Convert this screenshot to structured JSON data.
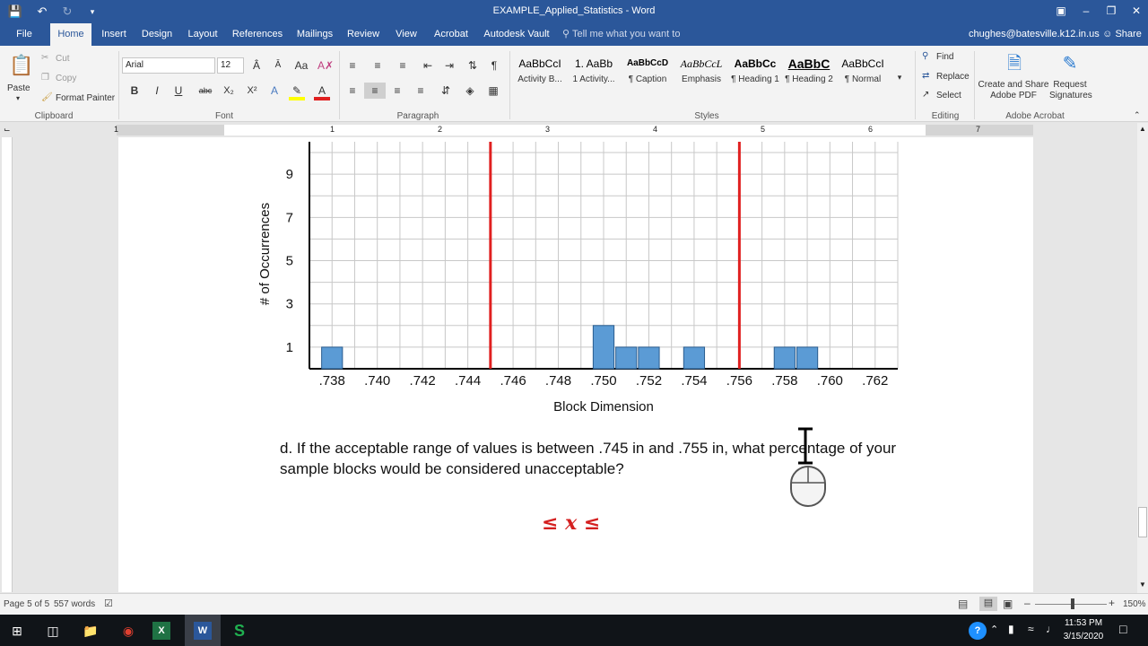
{
  "window": {
    "title": "EXAMPLE_Applied_Statistics - Word",
    "qat": [
      "save-icon",
      "undo-icon",
      "redo-icon",
      "customize-icon"
    ],
    "controls": [
      "ribbon-display-icon",
      "minimize-icon",
      "restore-icon",
      "close-icon"
    ]
  },
  "tabs": {
    "items": [
      "File",
      "Home",
      "Insert",
      "Design",
      "Layout",
      "References",
      "Mailings",
      "Review",
      "View",
      "Acrobat",
      "Autodesk Vault"
    ],
    "tell_me": "Tell me what you want to do...",
    "user": "chughes@batesville.k12.in.us",
    "share": "Share"
  },
  "ribbon": {
    "clipboard": {
      "paste": "Paste",
      "cut": "Cut",
      "copy": "Copy",
      "format_painter": "Format Painter",
      "label": "Clipboard"
    },
    "font": {
      "name": "Arial",
      "size": "12",
      "label": "Font",
      "bold": "B",
      "italic": "I",
      "underline": "U",
      "strike": "abc",
      "sub": "X₂",
      "sup": "X²"
    },
    "paragraph": {
      "label": "Paragraph",
      "pilcrow": "¶"
    },
    "styles": {
      "label": "Styles",
      "items": [
        {
          "preview": "AaBbCcI",
          "name": "Activity B..."
        },
        {
          "preview": "1.  AaBb",
          "name": "1 Activity..."
        },
        {
          "preview": "AaBbCcD",
          "name": "¶ Caption"
        },
        {
          "preview": "AaBbCcL",
          "name": "Emphasis"
        },
        {
          "preview": "AaBbCc",
          "name": "¶ Heading 1"
        },
        {
          "preview": "AaBbC",
          "name": "¶ Heading 2"
        },
        {
          "preview": "AaBbCcI",
          "name": "¶ Normal"
        }
      ]
    },
    "editing": {
      "find": "Find",
      "replace": "Replace",
      "select": "Select",
      "label": "Editing"
    },
    "acrobat": {
      "create": "Create and Share Adobe PDF",
      "request": "Request Signatures",
      "label": "Adobe Acrobat"
    }
  },
  "ruler": {
    "marks": [
      "1",
      "1",
      "2",
      "3",
      "4",
      "5",
      "6",
      "7"
    ]
  },
  "document": {
    "question": "d. If the acceptable range of values is between .745 in and .755 in, what percentage of your sample blocks would be considered unacceptable?",
    "formula": "≤ x ≤"
  },
  "chart_data": {
    "type": "bar",
    "xlabel": "Block Dimension",
    "ylabel": "# of Occurrences",
    "x_tick_labels": [
      ".738",
      ".740",
      ".742",
      ".744",
      ".746",
      ".748",
      ".750",
      ".752",
      ".754",
      ".756",
      ".758",
      ".760",
      ".762"
    ],
    "y_tick_labels": [
      "1",
      "3",
      "5",
      "7",
      "9"
    ],
    "ylim": [
      0,
      10.5
    ],
    "xlim": [
      0.737,
      0.763
    ],
    "bars": [
      {
        "x": 0.738,
        "value": 1
      },
      {
        "x": 0.75,
        "value": 2
      },
      {
        "x": 0.751,
        "value": 1
      },
      {
        "x": 0.752,
        "value": 1
      },
      {
        "x": 0.754,
        "value": 1
      },
      {
        "x": 0.758,
        "value": 1
      },
      {
        "x": 0.759,
        "value": 1
      }
    ],
    "reference_lines": [
      0.745,
      0.756
    ],
    "bar_color": "#5b9bd5",
    "line_color": "#e02020",
    "grid": true
  },
  "status": {
    "page": "Page 5 of 5",
    "words": "557 words",
    "zoom": "150%"
  },
  "taskbar": {
    "apps": [
      "start-icon",
      "task-view-icon",
      "file-explorer-icon",
      "chrome-icon",
      "excel-icon",
      "word-icon",
      "s-app-icon"
    ],
    "time": "11:53 PM",
    "date": "3/15/2020"
  }
}
